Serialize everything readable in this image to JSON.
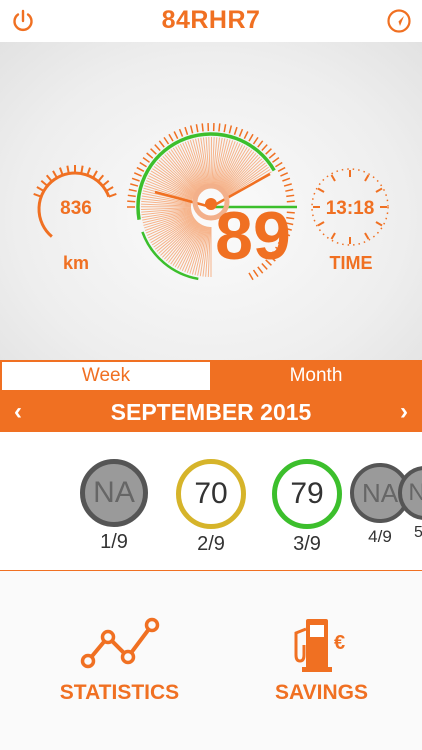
{
  "header": {
    "title": "84RHR7",
    "power_icon": "power-icon",
    "locate_icon": "navigation-icon"
  },
  "dashboard": {
    "distance_value": "836",
    "distance_unit": "km",
    "score_value": "89",
    "time_value": "13:18",
    "time_label": "TIME"
  },
  "toggle": {
    "week": "Week",
    "month": "Month",
    "selected": "Week"
  },
  "month_nav": {
    "prev": "‹",
    "label": "SEPTEMBER 2015",
    "next": "›"
  },
  "days": [
    {
      "score": "NA",
      "date": "1/9",
      "status": "none"
    },
    {
      "score": "70",
      "date": "2/9",
      "status": "yellow"
    },
    {
      "score": "79",
      "date": "3/9",
      "status": "green"
    },
    {
      "score": "NA",
      "date": "4/9",
      "status": "none"
    },
    {
      "score": "NA",
      "date": "5",
      "status": "none"
    }
  ],
  "bottom": {
    "statistics_label": "STATISTICS",
    "savings_label": "SAVINGS"
  },
  "colors": {
    "accent": "#f07022",
    "green": "#3cbf2c",
    "yellow": "#d6b42a",
    "grey": "#9a9a9a"
  }
}
